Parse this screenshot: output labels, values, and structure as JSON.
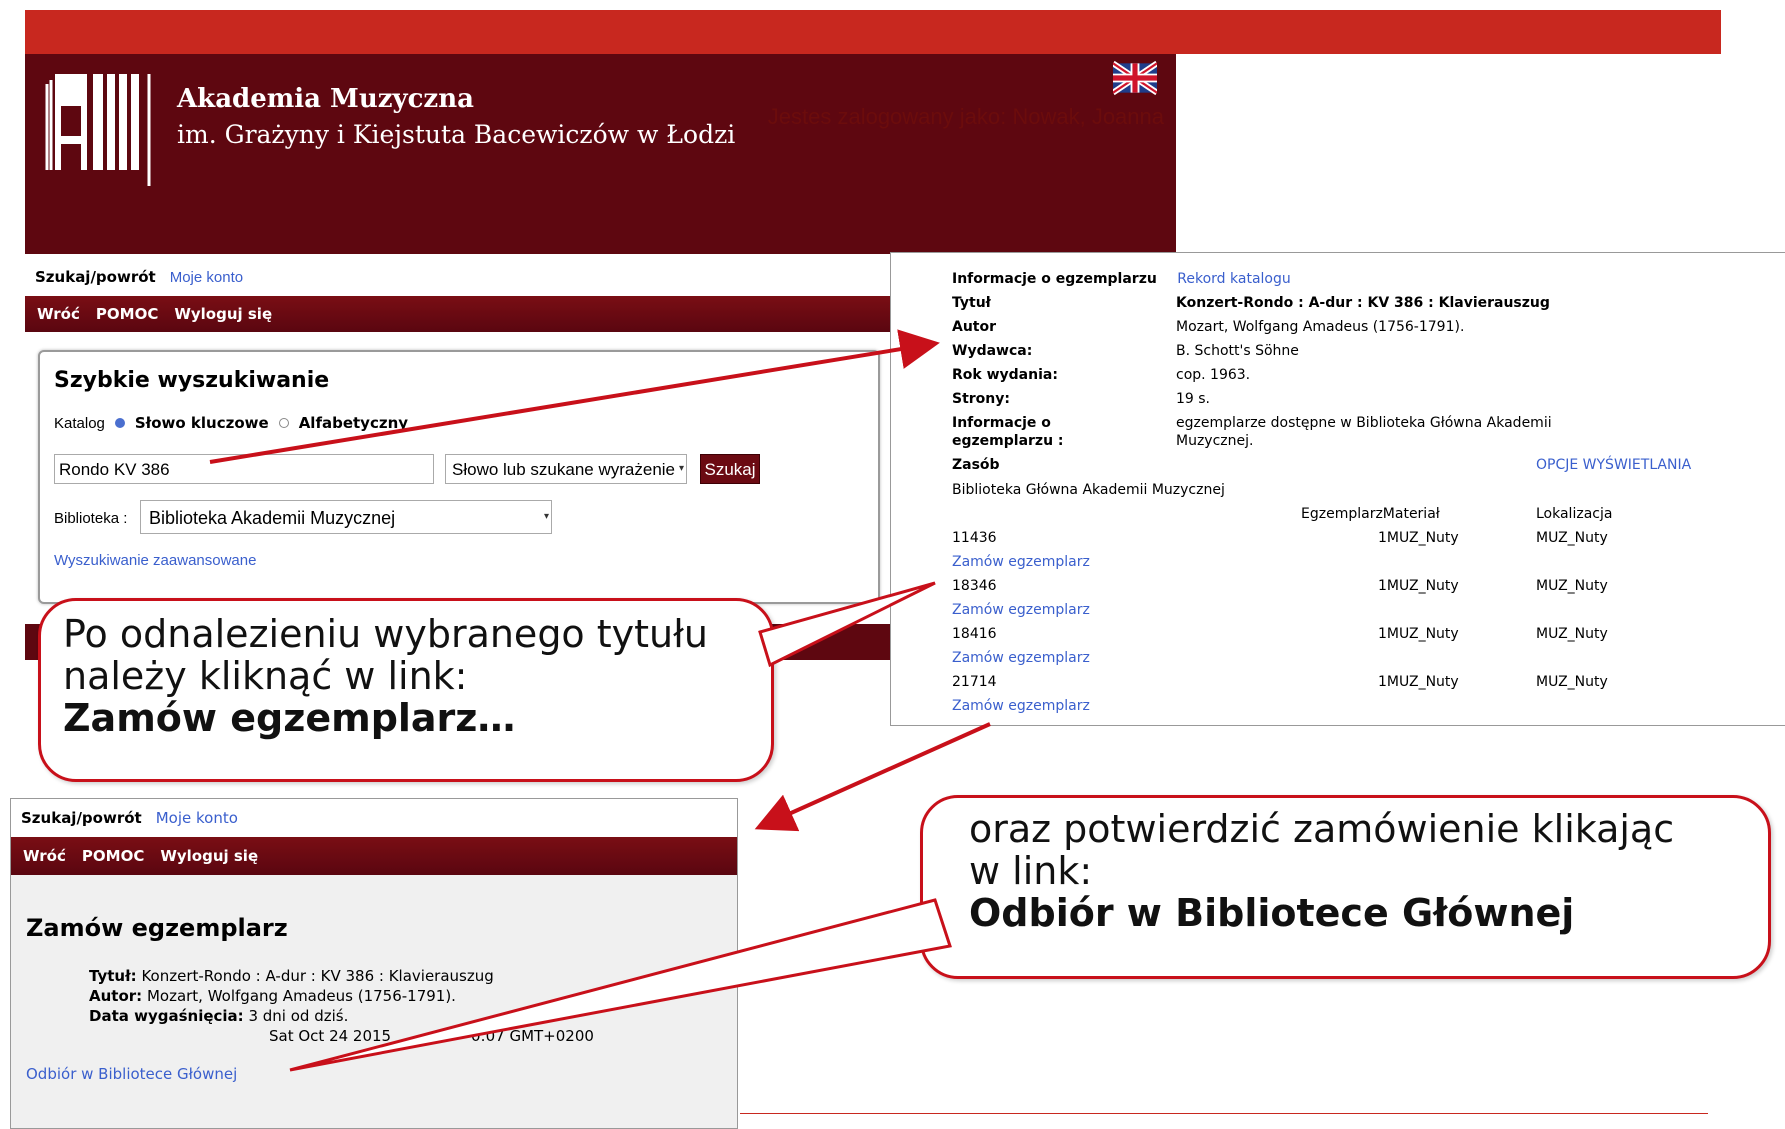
{
  "header": {
    "line1": "Akademia Muzyczna",
    "line2": "im. Grażyny i Kiejstuta Bacewiczów w Łodzi",
    "logged_in": "Jestes zalogowany jako: Nowak, Joanna",
    "flag_icon": "uk-flag-icon"
  },
  "nav": {
    "search": "Szukaj/powrót",
    "account": "Moje konto",
    "back": "Wróć",
    "help": "POMOC",
    "logout": "Wyloguj się"
  },
  "search": {
    "title": "Szybkie wyszukiwanie",
    "catalog_label": "Katalog",
    "opt1": "Słowo kluczowe",
    "opt2": "Alfabetyczny",
    "query": "Rondo  KV 386",
    "mode": "Słowo lub szukane wyrażenie",
    "button": "Szukaj",
    "library_label": "Biblioteka :",
    "library": "Biblioteka Akademii Muzycznej",
    "advanced": "Wyszukiwanie zaawansowane"
  },
  "record": {
    "heading": "Informacje o egzemplarzu",
    "catalog_link": "Rekord katalogu",
    "fields": [
      {
        "label": "Tytuł",
        "value": "Konzert-Rondo : A-dur : KV 386 : Klavierauszug"
      },
      {
        "label": "Autor",
        "value": "Mozart, Wolfgang Amadeus (1756-1791)."
      },
      {
        "label": "Wydawca:",
        "value": "B. Schott's Söhne"
      },
      {
        "label": "Rok wydania:",
        "value": "cop. 1963."
      },
      {
        "label": "Strony:",
        "value": "19 s."
      }
    ],
    "info_label_1": "Informacje o",
    "info_label_2": "egzemplarzu :",
    "info_value_1": "egzemplarze dostępne w Biblioteka Główna Akademii",
    "info_value_2": "Muzycznej.",
    "holdings": "Zasób",
    "options": "OPCJE WYŚWIETLANIA",
    "library": "Biblioteka Główna Akademii Muzycznej",
    "col_copy": "EgzemplarzMateriał",
    "col_loc": "Lokalizacja",
    "copies": [
      {
        "id": "11436",
        "material": "1MUZ_Nuty",
        "location": "MUZ_Nuty",
        "order": "Zamów egzemplarz"
      },
      {
        "id": "18346",
        "material": "1MUZ_Nuty",
        "location": "MUZ_Nuty",
        "order": "Zamów egzemplarz"
      },
      {
        "id": "18416",
        "material": "1MUZ_Nuty",
        "location": "MUZ_Nuty",
        "order": "Zamów egzemplarz"
      },
      {
        "id": "21714",
        "material": "1MUZ_Nuty",
        "location": "MUZ_Nuty",
        "order": "Zamów egzemplarz"
      }
    ]
  },
  "callout1": {
    "line1": "Po odnalezieniu wybranego tytułu",
    "line2": "należy kliknąć w link:",
    "line3": "Zamów egzemplarz…"
  },
  "callout2": {
    "line1": "oraz potwierdzić zamówienie klikając",
    "line2": "w link:",
    "line3": "Odbiór w Bibliotece Głównej"
  },
  "order": {
    "title": "Zamów egzemplarz",
    "title_label": "Tytuł:",
    "title_value": "Konzert-Rondo : A-dur : KV 386 : Klavierauszug",
    "author_label": "Autor:",
    "author_value": "Mozart, Wolfgang Amadeus (1756-1791).",
    "expiry_label": "Data wygaśnięcia:",
    "expiry_value": "3 dni od dziś.",
    "expiry_date_left": "Sat Oct 24 2015",
    "expiry_date_right": "0:07 GMT+0200",
    "pickup": "Odbiór w Bibliotece Głównej"
  },
  "colors": {
    "dark_red": "#5e0710",
    "bright_red": "#c8281f",
    "link": "#3a5fcd"
  }
}
